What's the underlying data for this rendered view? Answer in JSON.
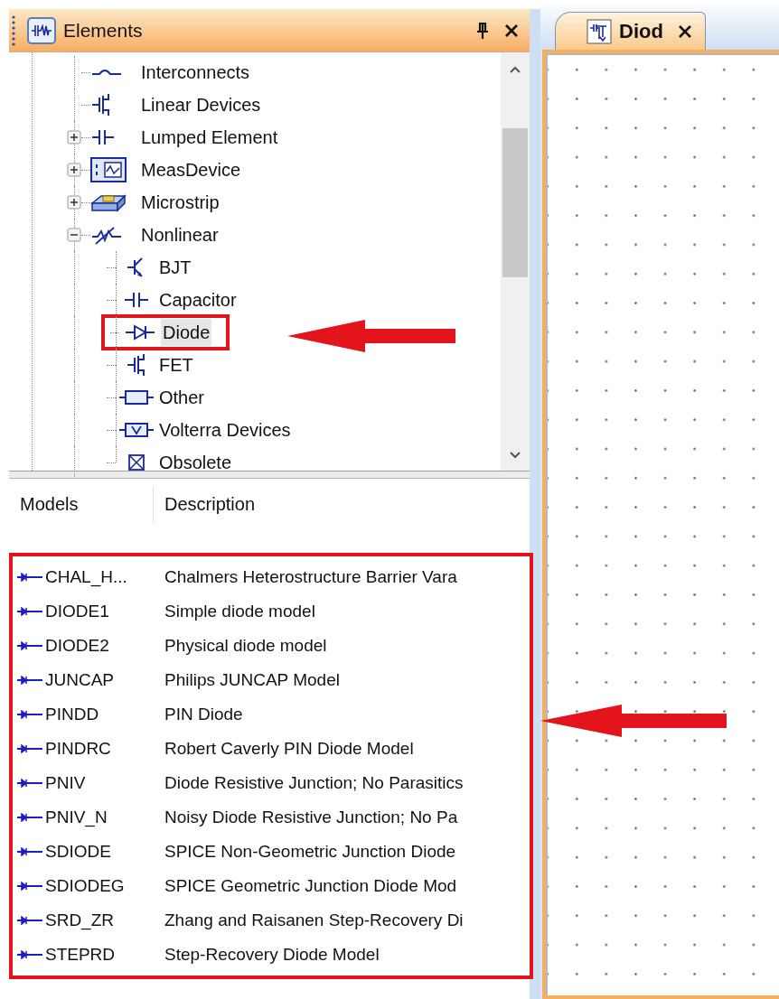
{
  "elements_panel": {
    "title": "Elements",
    "tree": [
      {
        "label": "Interconnects"
      },
      {
        "label": "Linear Devices"
      },
      {
        "label": "Lumped Element",
        "expanded": false
      },
      {
        "label": "MeasDevice",
        "expanded": false
      },
      {
        "label": "Microstrip",
        "expanded": false
      },
      {
        "label": "Nonlinear",
        "expanded": true,
        "children": [
          {
            "label": "BJT",
            "selected": false,
            "callout": false
          },
          {
            "label": "Capacitor",
            "selected": false,
            "callout": false
          },
          {
            "label": "Diode",
            "selected": true,
            "callout": true
          },
          {
            "label": "FET",
            "selected": false,
            "callout": false
          },
          {
            "label": "Other",
            "selected": false,
            "callout": false
          },
          {
            "label": "Volterra Devices",
            "selected": false,
            "callout": false
          },
          {
            "label": "Obsolete",
            "selected": false,
            "callout": false
          }
        ]
      }
    ]
  },
  "models": {
    "columns": [
      "Models",
      "Description"
    ],
    "callout": true,
    "rows": [
      {
        "name": "CHAL_H...",
        "description": "Chalmers Heterostructure Barrier Vara"
      },
      {
        "name": "DIODE1",
        "description": "Simple diode model"
      },
      {
        "name": "DIODE2",
        "description": "Physical diode model"
      },
      {
        "name": "JUNCAP",
        "description": "Philips JUNCAP Model"
      },
      {
        "name": "PINDD",
        "description": "PIN Diode"
      },
      {
        "name": "PINDRC",
        "description": "Robert Caverly PIN Diode Model"
      },
      {
        "name": "PNIV",
        "description": "Diode Resistive Junction; No Parasitics"
      },
      {
        "name": "PNIV_N",
        "description": "Noisy Diode Resistive Junction; No Pa"
      },
      {
        "name": "SDIODE",
        "description": "SPICE Non-Geometric Junction Diode"
      },
      {
        "name": "SDIODEG",
        "description": "SPICE Geometric Junction Diode Mod"
      },
      {
        "name": "SRD_ZR",
        "description": "Zhang and Raisanen Step-Recovery Di"
      },
      {
        "name": "STEPRD",
        "description": "Step-Recovery Diode Model"
      }
    ]
  },
  "editor": {
    "tabs": [
      {
        "label": "Diod",
        "selected": true
      }
    ]
  }
}
